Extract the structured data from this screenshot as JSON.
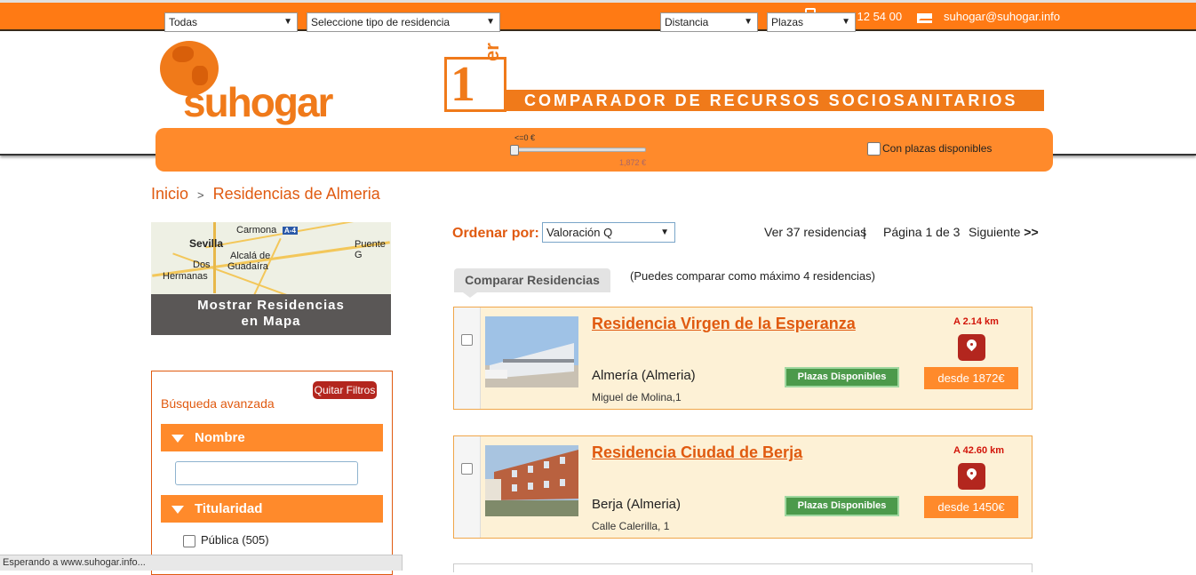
{
  "topbar": {
    "phone": "+ 955 12 54 00",
    "email": "suhogar@suhogar.info"
  },
  "header": {
    "logo_text": "suhogar",
    "badge_num": "1",
    "badge_sup": "er",
    "banner": "COMPARADOR DE RECURSOS SOCIOSANITARIOS"
  },
  "filters": {
    "location": "Todas",
    "type": "Seleccione tipo de residencia",
    "price_min_label": "<=0 €",
    "price_max_label": "1,872 €",
    "distance": "Distancia",
    "places": "Plazas",
    "available_label": "Con plazas disponibles"
  },
  "breadcrumb": {
    "home": "Inicio",
    "sep": ">",
    "current": "Residencias de Almeria"
  },
  "map": {
    "button_line1": "Mostrar Residencias",
    "button_line2": "en Mapa",
    "labels": [
      "Carmona",
      "Sevilla",
      "Alcalá de",
      "Guadaíra",
      "Dos",
      "Hermanas",
      "Puente G"
    ],
    "road": "A-4"
  },
  "sidebar": {
    "title": "Búsqueda avanzada",
    "quit_filters": "Quitar Filtros",
    "sections": [
      "Nombre",
      "Titularidad"
    ],
    "option_publica": "Pública (505)"
  },
  "sort": {
    "label": "Ordenar por:",
    "value": "Valoración Q",
    "count": "Ver 37 residencias",
    "sep": "|",
    "page": "Página 1 de 3",
    "next": "Siguiente"
  },
  "compare": {
    "button": "Comparar Residencias",
    "note": "(Puedes comparar como máximo 4 residencias)"
  },
  "results": [
    {
      "name": "Residencia Virgen de la Esperanza",
      "city": "Almería (Almeria)",
      "address": "Miguel de Molina,1",
      "availability": "Plazas Disponibles",
      "distance": "A 2.14 km",
      "price": "desde 1872€"
    },
    {
      "name": "Residencia Ciudad de Berja",
      "city": "Berja (Almeria)",
      "address": "Calle Calerilla, 1",
      "availability": "Plazas Disponibles",
      "distance": "A 42.60 km",
      "price": "desde 1450€"
    }
  ],
  "statusbar": "Esperando a www.suhogar.info...",
  "colors": {
    "brand_orange": "#ff7a14",
    "accent_red": "#b3261e",
    "available_green": "#4c9a4b"
  }
}
